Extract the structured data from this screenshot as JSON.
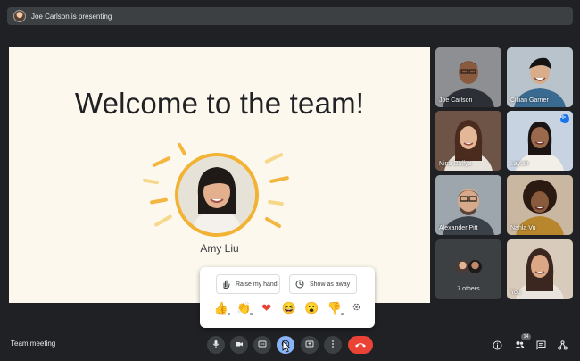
{
  "presenting_bar": {
    "text": "Joe Carlson is presenting"
  },
  "slide": {
    "title": "Welcome to the team!",
    "speaker_name": "Amy Liu"
  },
  "participants": [
    {
      "name": "Joe Carlson"
    },
    {
      "name": "Cillian Garner"
    },
    {
      "name": "Nina Daffya"
    },
    {
      "name": "Laylah"
    },
    {
      "name": "Alexander Pitt"
    },
    {
      "name": "Nahla Vu"
    },
    {
      "name": "7 others"
    },
    {
      "name": "You"
    }
  ],
  "popup": {
    "raise_hand": "Raise my hand",
    "show_away": "Show as away",
    "reactions": [
      "👍",
      "👏",
      "❤",
      "😆",
      "😮",
      "👎"
    ]
  },
  "meeting": {
    "name": "Team meeting"
  },
  "people_count": "14",
  "colors": {
    "accent": "#8ab4f8",
    "hangup": "#ea4335",
    "slide_ring": "#f2b233"
  }
}
